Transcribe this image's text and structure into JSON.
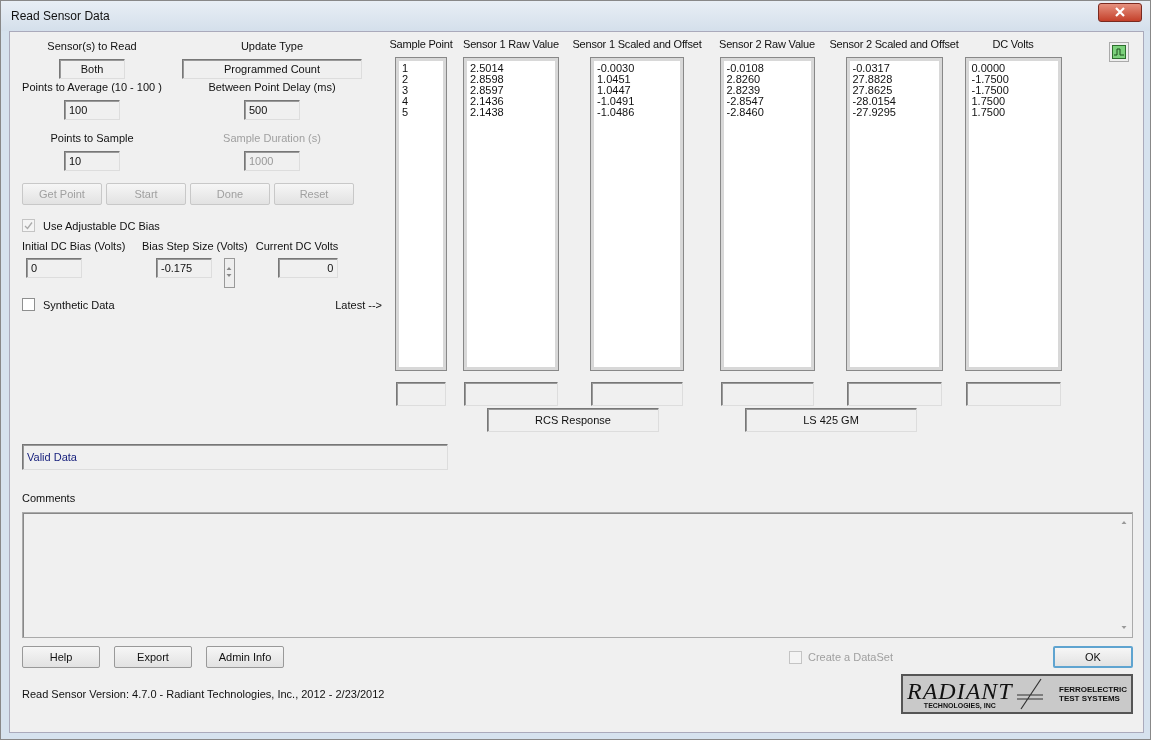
{
  "window": {
    "title": "Read Sensor Data"
  },
  "left": {
    "sensors_label": "Sensor(s) to Read",
    "sensors_value": "Both",
    "update_label": "Update Type",
    "update_value": "Programmed Count",
    "fields": [
      {
        "label": "Points to Average (10 - 100 )",
        "value": "100",
        "disabled": false
      },
      {
        "label": "Between Point Delay (ms)",
        "value": "500",
        "disabled": false
      },
      {
        "label": "Points to Sample",
        "value": "10",
        "disabled": false
      },
      {
        "label": "Sample Duration (s)",
        "value": "1000",
        "disabled": true
      }
    ],
    "action_buttons": [
      {
        "label": "Get Point",
        "disabled": true
      },
      {
        "label": "Start",
        "disabled": true
      },
      {
        "label": "Done",
        "disabled": true
      },
      {
        "label": "Reset",
        "disabled": true
      }
    ],
    "dc_bias": {
      "label": "Use Adjustable DC Bias",
      "checked": true,
      "disabled": true
    },
    "bias_fields": [
      {
        "label": "Initial DC Bias (Volts)",
        "value": "0"
      },
      {
        "label": "Bias Step Size (Volts)",
        "value": "-0.175"
      },
      {
        "label": "Current DC Volts",
        "value": "0"
      }
    ],
    "synthetic": {
      "label": "Synthetic Data",
      "checked": false,
      "disabled": false
    },
    "latest_label": "Latest -->"
  },
  "columns": [
    {
      "header": "Sample Point",
      "values": [
        "1",
        "2",
        "3",
        "4",
        "5"
      ]
    },
    {
      "header": "Sensor 1 Raw Value",
      "values": [
        "2.5014",
        "2.8598",
        "2.8597",
        "2.1436",
        "2.1438"
      ]
    },
    {
      "header": "Sensor 1 Scaled and Offset",
      "values": [
        "-0.0030",
        "1.0451",
        "1.0447",
        "-1.0491",
        "-1.0486"
      ]
    },
    {
      "header": "Sensor 2 Raw Value",
      "values": [
        "-0.0108",
        "2.8260",
        "2.8239",
        "-2.8547",
        "-2.8460"
      ]
    },
    {
      "header": "Sensor 2 Scaled and Offset",
      "values": [
        "-0.0317",
        "27.8828",
        "27.8625",
        "-28.0154",
        "-27.9295"
      ]
    },
    {
      "header": "DC Volts",
      "values": [
        "0.0000",
        "-1.7500",
        "-1.7500",
        "1.7500",
        "1.7500"
      ]
    }
  ],
  "sensor_names": [
    "RCS Response",
    "LS 425 GM"
  ],
  "status": "Valid Data",
  "comments_label": "Comments",
  "buttons": [
    "Help",
    "Export",
    "Admin Info"
  ],
  "create_dataset": {
    "label": "Create a DataSet",
    "checked": false,
    "disabled": true
  },
  "ok": "OK",
  "footer": "Read Sensor Version: 4.7.0 - Radiant Technologies, Inc., 2012 - 2/23/2012",
  "logo": {
    "name": "RADIANT",
    "sub": "TECHNOLOGIES, INC",
    "right1": "FERROELECTRIC",
    "right2": "TEST SYSTEMS"
  }
}
